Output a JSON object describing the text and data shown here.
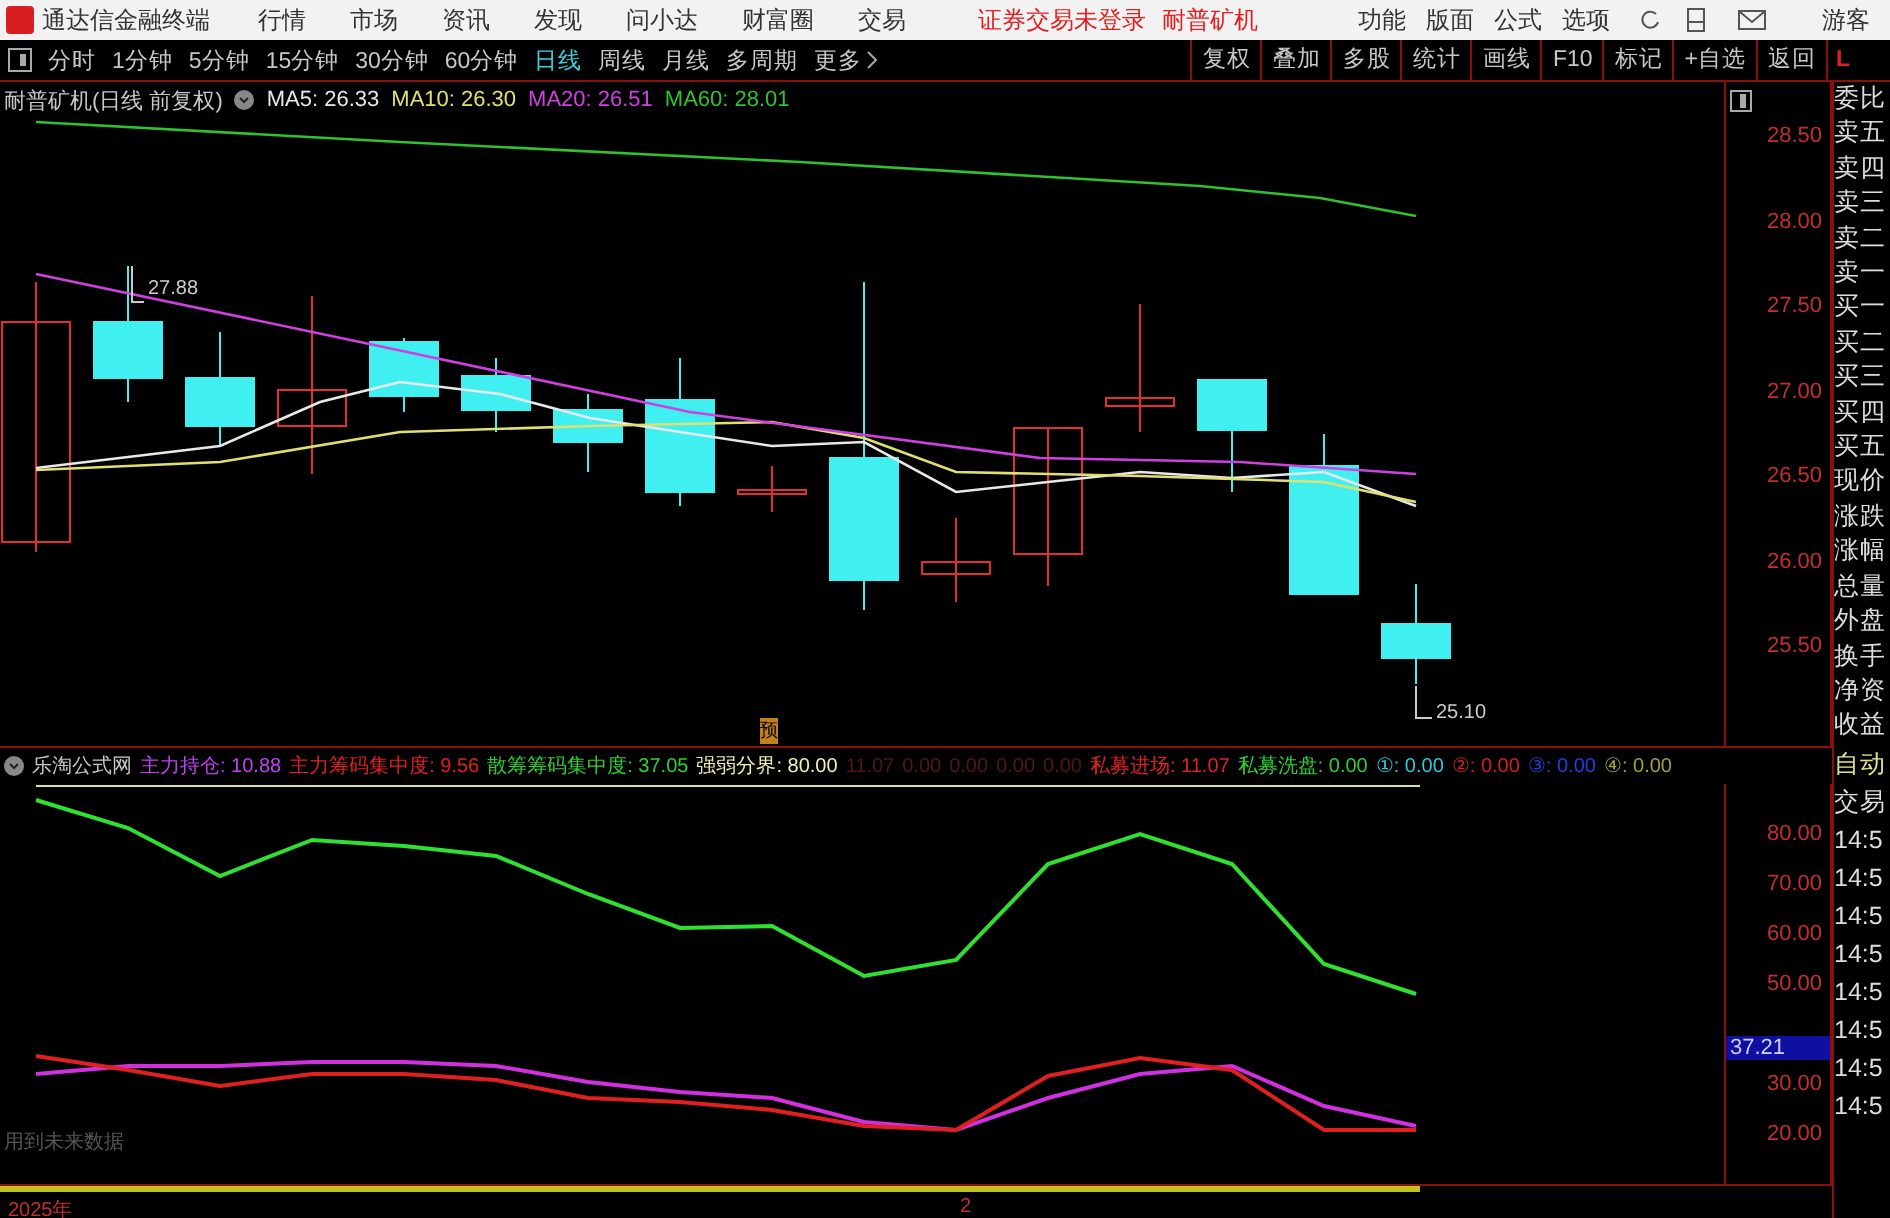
{
  "menu_bar": {
    "app_title": "通达信金融终端",
    "menus": [
      "行情",
      "市场",
      "资讯",
      "发现",
      "问小达",
      "财富圈",
      "交易"
    ],
    "status": [
      "证券交易未登录",
      "耐普矿机"
    ],
    "right_menus": [
      "功能",
      "版面",
      "公式",
      "选项"
    ],
    "user": "游客"
  },
  "period_tabs": [
    {
      "label": "分时",
      "selected": false
    },
    {
      "label": "1分钟",
      "selected": false
    },
    {
      "label": "5分钟",
      "selected": false
    },
    {
      "label": "15分钟",
      "selected": false
    },
    {
      "label": "30分钟",
      "selected": false
    },
    {
      "label": "60分钟",
      "selected": false
    },
    {
      "label": "日线",
      "selected": true
    },
    {
      "label": "周线",
      "selected": false
    },
    {
      "label": "月线",
      "selected": false
    },
    {
      "label": "多周期",
      "selected": false
    }
  ],
  "more": "更多",
  "chart_tools": [
    "复权",
    "叠加",
    "多股",
    "统计",
    "画线",
    "F10",
    "标记",
    "+自选",
    "返回"
  ],
  "level_badge": "L",
  "main_chart": {
    "title": "耐普矿机(日线 前复权)",
    "ma": [
      {
        "label": "MA5: 26.33",
        "color": "#e8e8e8"
      },
      {
        "label": "MA10: 26.30",
        "color": "#e0e070"
      },
      {
        "label": "MA20: 26.51",
        "color": "#d040e0"
      },
      {
        "label": "MA60: 28.01",
        "color": "#30c030"
      }
    ],
    "price_axis": [
      "28.50",
      "28.00",
      "27.50",
      "27.00",
      "26.50",
      "26.00",
      "25.50"
    ],
    "high_label": "27.88",
    "low_label": "25.10",
    "marker": "预"
  },
  "indicator": {
    "title": "乐淘公式网",
    "items": [
      {
        "label": "主力持仓: 10.88",
        "color": "#c040f0"
      },
      {
        "label": "主力筹码集中度: 9.56",
        "color": "#e02020"
      },
      {
        "label": "散筹筹码集中度: 37.05",
        "color": "#30d030"
      },
      {
        "label": "强弱分界: 80.00",
        "color": "#f0f0b0"
      },
      {
        "label": "11.07",
        "color": "#501818"
      },
      {
        "label": "0.00",
        "color": "#501818"
      },
      {
        "label": "0.00",
        "color": "#501818"
      },
      {
        "label": "0.00",
        "color": "#501818"
      },
      {
        "label": "0.00",
        "color": "#501818"
      },
      {
        "label": "私募进场: 11.07",
        "color": "#e02020"
      },
      {
        "label": "私募洗盘: 0.00",
        "color": "#30d030"
      },
      {
        "label": "①: 0.00",
        "color": "#30c8d8"
      },
      {
        "label": "②: 0.00",
        "color": "#d02020"
      },
      {
        "label": "③: 0.00",
        "color": "#2040e0"
      },
      {
        "label": "④: 0.00",
        "color": "#a0a040"
      }
    ],
    "current_value": "37.21",
    "chart_data": {
      "type": "line",
      "categories": [
        null,
        null,
        null,
        null,
        null,
        null,
        null,
        null,
        null,
        null,
        null,
        null,
        null,
        null,
        null,
        null
      ],
      "ylim": [
        10.8,
        90
      ],
      "yticks": [
        {
          "value": 80,
          "label": "80.00"
        },
        {
          "value": 70,
          "label": "70.00"
        },
        {
          "value": 60,
          "label": "60.00"
        },
        {
          "value": 50,
          "label": "50.00"
        },
        {
          "value": 30,
          "label": "30.00"
        },
        {
          "value": 20,
          "label": "20.00"
        }
      ],
      "series": [
        {
          "color": "#30e030",
          "values": [
            87.4,
            81.8,
            72.2,
            79.4,
            78.2,
            76.2,
            68.6,
            61.8,
            62.2,
            52.2,
            55.4,
            74.6,
            80.6,
            74.6,
            54.6,
            48.6
          ]
        },
        {
          "color": "#d030e0",
          "values": [
            32.6,
            34.2,
            34.2,
            35,
            35,
            34.2,
            31,
            29,
            27.8,
            23,
            21.4,
            27.8,
            32.6,
            34.2,
            26.2,
            22.2
          ]
        },
        {
          "color": "#e02020",
          "values": [
            36.2,
            33.4,
            30.2,
            32.6,
            32.6,
            31.4,
            27.8,
            27,
            25.4,
            22.2,
            21.4,
            32.2,
            35.8,
            33.4,
            21.4,
            21.4
          ]
        }
      ]
    }
  },
  "notice": "用到未来数据",
  "time_axis": [
    "2025年",
    "2"
  ],
  "quote_panel": [
    "委比",
    "卖五",
    "卖四",
    "卖三",
    "卖二",
    "卖一",
    "买一",
    "买二",
    "买三",
    "买四",
    "买五",
    "现价",
    "涨跌",
    "涨幅",
    "总量",
    "外盘",
    "换手",
    "净资",
    "收益"
  ],
  "auto_label": "自动",
  "trade_label": "交易",
  "trade_times": [
    "14:5",
    "14:5",
    "14:5",
    "14:5",
    "14:5",
    "14:5",
    "14:5",
    "14:5"
  ]
}
